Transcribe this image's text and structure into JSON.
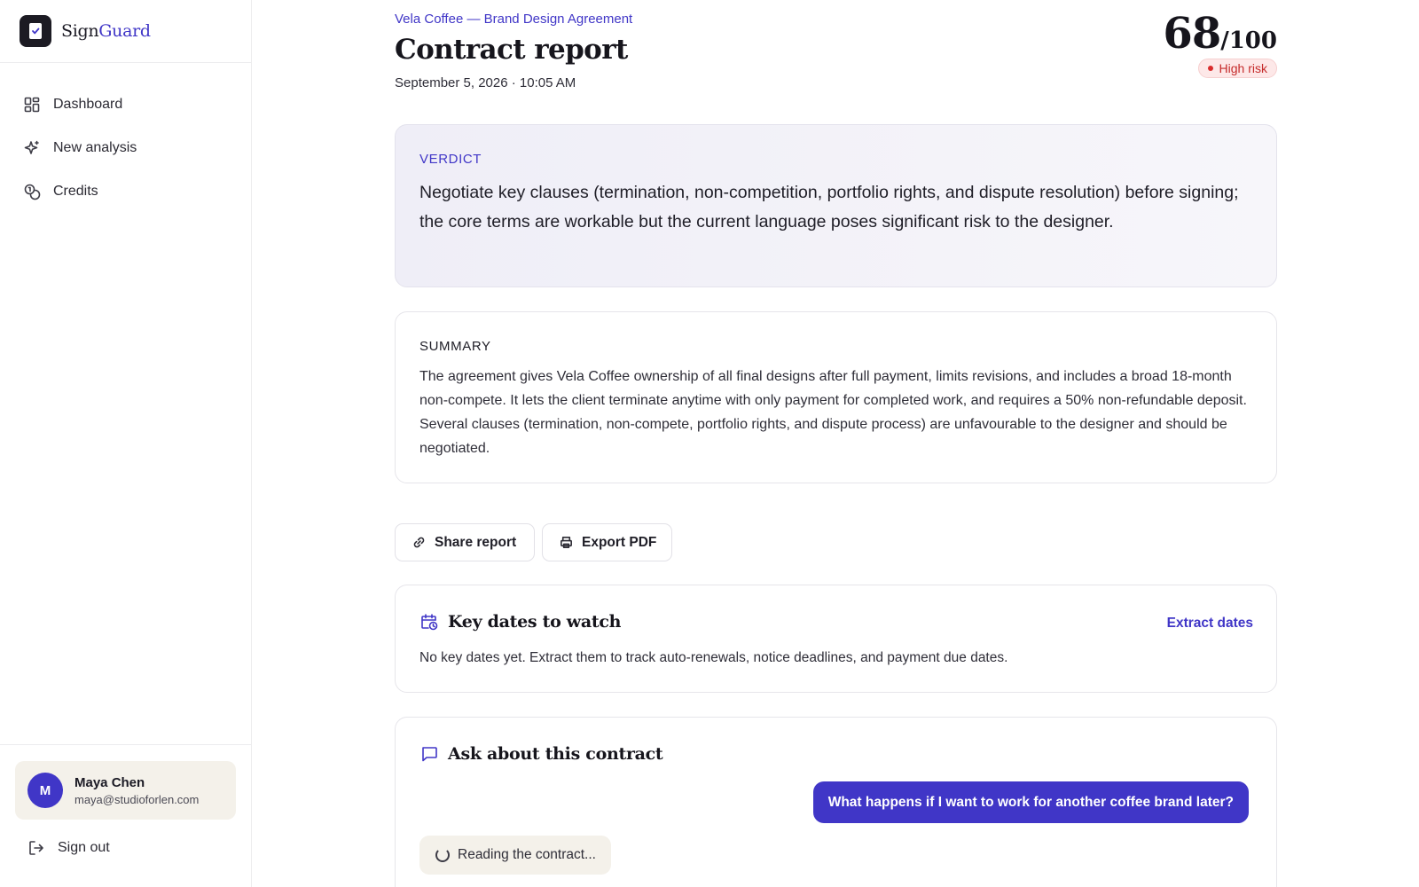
{
  "app": {
    "name_primary": "Sign",
    "name_accent": "Guard",
    "accent_color": "#4036c7"
  },
  "sidebar": {
    "items": [
      {
        "label": "Dashboard",
        "icon": "grid-icon"
      },
      {
        "label": "New analysis",
        "icon": "sparkle-icon"
      },
      {
        "label": "Credits",
        "icon": "coins-icon"
      }
    ],
    "user": {
      "initial": "M",
      "name": "Maya Chen",
      "email": "maya@studioforlen.com"
    },
    "signout_label": "Sign out"
  },
  "report": {
    "contract_name": "Vela Coffee — Brand Design Agreement",
    "title": "Contract report",
    "datetime": "September 5, 2026 · 10:05 AM",
    "score": "68",
    "score_max": "/100",
    "risk_label": "High risk",
    "risk_color": "#c52b2b"
  },
  "verdict": {
    "heading": "VERDICT",
    "text": "Negotiate key clauses (termination, non-competition, portfolio rights, and dispute resolution) before signing; the core terms are workable but the current language poses significant risk to the designer."
  },
  "summary": {
    "heading": "SUMMARY",
    "text": "The agreement gives Vela Coffee ownership of all final designs after full payment, limits revisions, and includes a broad 18-month non-compete. It lets the client terminate anytime with only payment for completed work, and requires a 50% non-refundable deposit. Several clauses (termination, non-compete, portfolio rights, and dispute process) are unfavourable to the designer and should be negotiated."
  },
  "actions": {
    "share_label": "Share report",
    "export_label": "Export PDF"
  },
  "key_dates": {
    "heading": "Key dates to watch",
    "action_label": "Extract dates",
    "empty_text": "No key dates yet. Extract them to track auto-renewals, notice deadlines, and payment due dates."
  },
  "ask": {
    "heading": "Ask about this contract",
    "user_message": "What happens if I want to work for another coffee brand later?",
    "loading_text": "Reading the contract..."
  }
}
